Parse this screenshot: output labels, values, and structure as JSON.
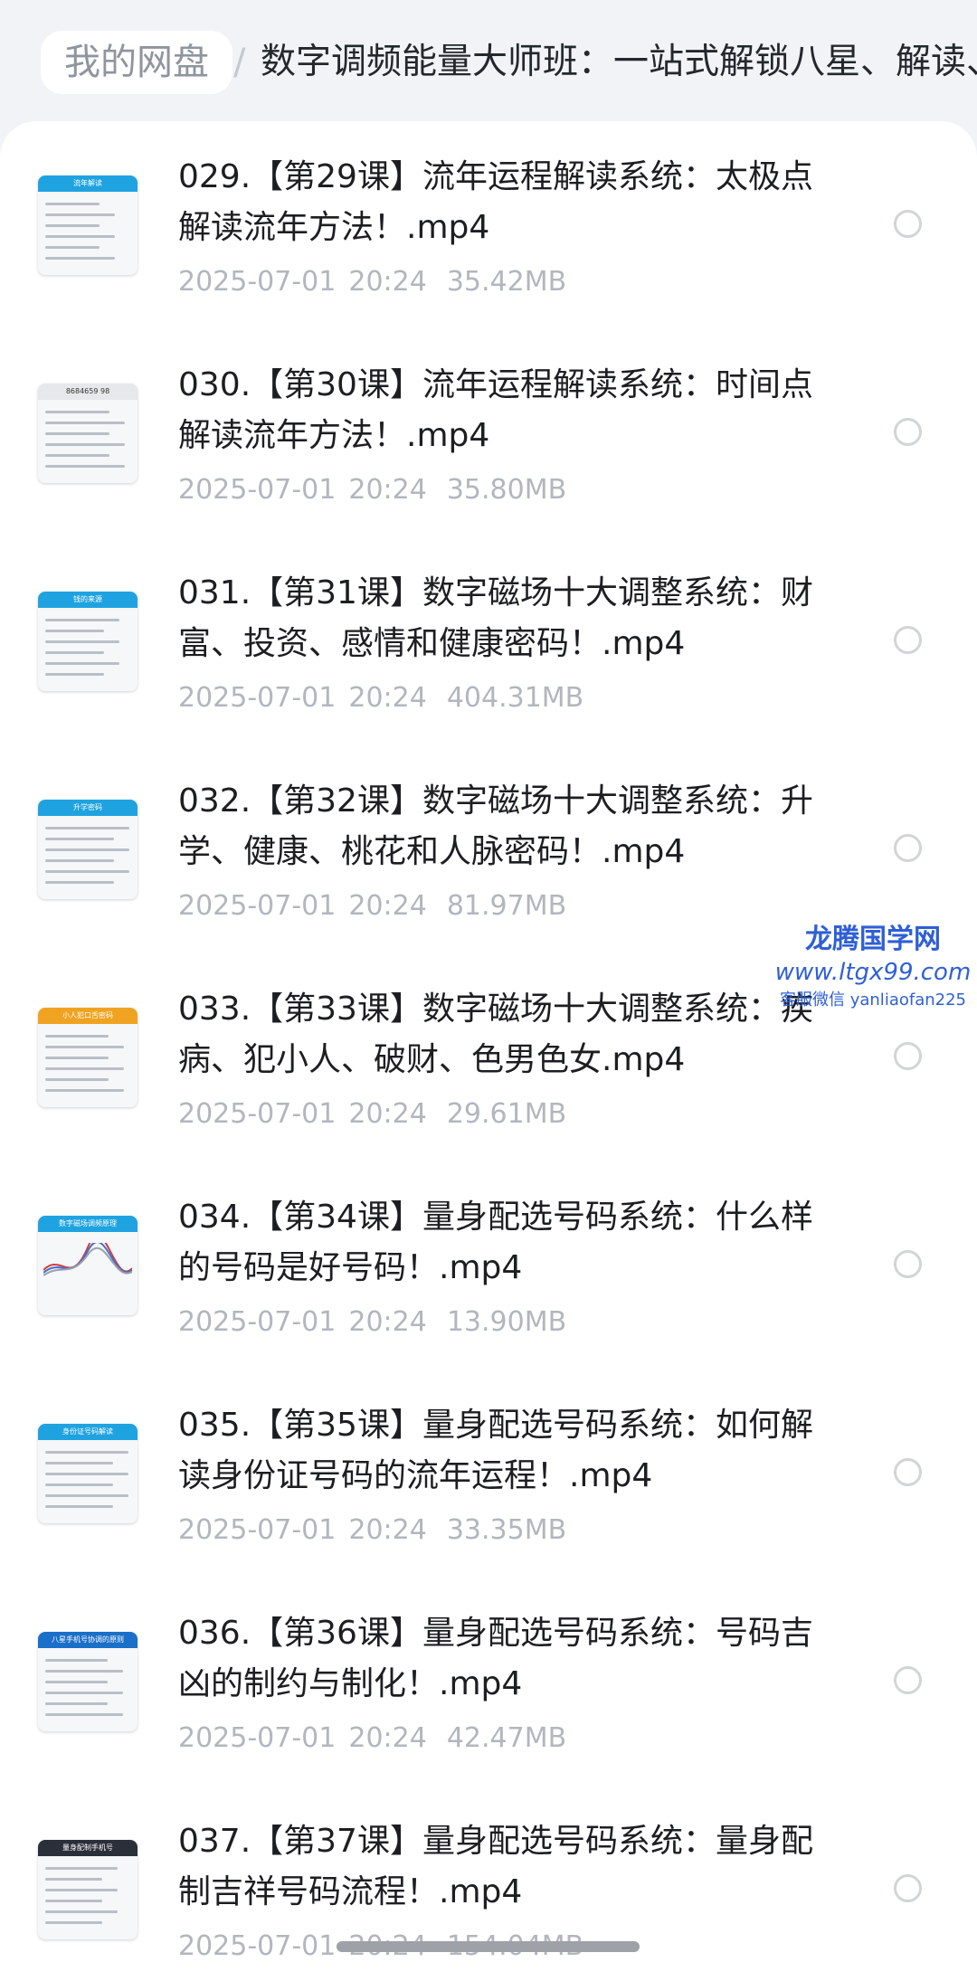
{
  "breadcrumb": {
    "home": "我的网盘",
    "separator": "/",
    "current": "数字调频能量大师班：一站式解锁八星、解读、"
  },
  "files": [
    {
      "name": "029.【第29课】流年运程解读系统：太极点解读流年方法！.mp4",
      "date": "2025-07-01",
      "time": "20:24",
      "size": "35.42MB",
      "thumb_label": "流年解读",
      "thumb_color": "#1fa3e0"
    },
    {
      "name": "030.【第30课】流年运程解读系统：时间点解读流年方法！.mp4",
      "date": "2025-07-01",
      "time": "20:24",
      "size": "35.80MB",
      "thumb_label": "8684659 98",
      "thumb_color": "#e6e8ec"
    },
    {
      "name": "031.【第31课】数字磁场十大调整系统：财富、投资、感情和健康密码！.mp4",
      "date": "2025-07-01",
      "time": "20:24",
      "size": "404.31MB",
      "thumb_label": "钱的来源",
      "thumb_color": "#1fa3e0"
    },
    {
      "name": "032.【第32课】数字磁场十大调整系统：升学、健康、桃花和人脉密码！.mp4",
      "date": "2025-07-01",
      "time": "20:24",
      "size": "81.97MB",
      "thumb_label": "升学密码",
      "thumb_color": "#1fa3e0"
    },
    {
      "name": "033.【第33课】数字磁场十大调整系统：疾病、犯小人、破财、色男色女.mp4",
      "date": "2025-07-01",
      "time": "20:24",
      "size": "29.61MB",
      "thumb_label": "小人犯口舌密码",
      "thumb_color": "#f0a321"
    },
    {
      "name": "034.【第34课】量身配选号码系统：什么样的号码是好号码！.mp4",
      "date": "2025-07-01",
      "time": "20:24",
      "size": "13.90MB",
      "thumb_label": "数字磁场调频原理",
      "thumb_color": "#1fa3e0"
    },
    {
      "name": "035.【第35课】量身配选号码系统：如何解读身份证号码的流年运程！.mp4",
      "date": "2025-07-01",
      "time": "20:24",
      "size": "33.35MB",
      "thumb_label": "身份证号码解读",
      "thumb_color": "#1fa3e0"
    },
    {
      "name": "036.【第36课】量身配选号码系统：号码吉凶的制约与制化！.mp4",
      "date": "2025-07-01",
      "time": "20:24",
      "size": "42.47MB",
      "thumb_label": "八星手机号协调的原则",
      "thumb_color": "#1a6fc9"
    },
    {
      "name": "037.【第37课】量身配选号码系统：量身配制吉祥号码流程！.mp4",
      "date": "2025-07-01",
      "time": "20:24",
      "size": "154.04MB",
      "thumb_label": "量身配制手机号",
      "thumb_color": "#2a2f3a"
    }
  ],
  "watermark": {
    "title": "龙腾国学网",
    "url": "www.ltgx99.com",
    "contact": "客服微信 yanliaofan225"
  }
}
